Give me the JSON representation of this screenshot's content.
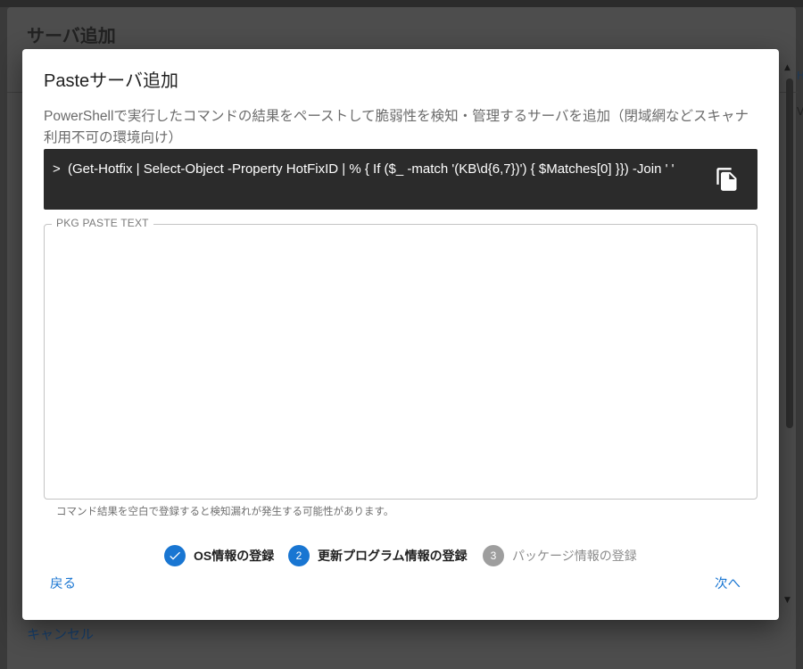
{
  "background": {
    "title": "サーバ追加",
    "cancel_label": "キャンセル",
    "right_link_fragment": "H",
    "right_text_fragment": "V"
  },
  "modal": {
    "title": "Pasteサーバ追加",
    "description": "PowerShellで実行したコマンドの結果をペーストして脆弱性を検知・管理するサーバを追加（閉域網などスキャナ利用不可の環境向け）",
    "command": {
      "prompt": ">",
      "text": "(Get-Hotfix | Select-Object -Property HotFixID | % { If ($_ -match '(KB\\d{6,7})') { $Matches[0] }}) -Join ' '",
      "copy_icon": "copy-icon"
    },
    "paste_field": {
      "label": "PKG PASTE TEXT",
      "value": "",
      "placeholder": ""
    },
    "helper_text": "コマンド結果を空白で登録すると検知漏れが発生する可能性があります。",
    "stepper": {
      "steps": [
        {
          "label": "OS情報の登録",
          "marker": "✓",
          "state": "completed"
        },
        {
          "label": "更新プログラム情報の登録",
          "marker": "2",
          "state": "active"
        },
        {
          "label": "パッケージ情報の登録",
          "marker": "3",
          "state": "pending"
        }
      ]
    },
    "back_label": "戻る",
    "next_label": "次へ"
  },
  "colors": {
    "primary": "#1976d2",
    "command_bg": "#2b2b2b",
    "pending_step": "#9e9e9e"
  }
}
